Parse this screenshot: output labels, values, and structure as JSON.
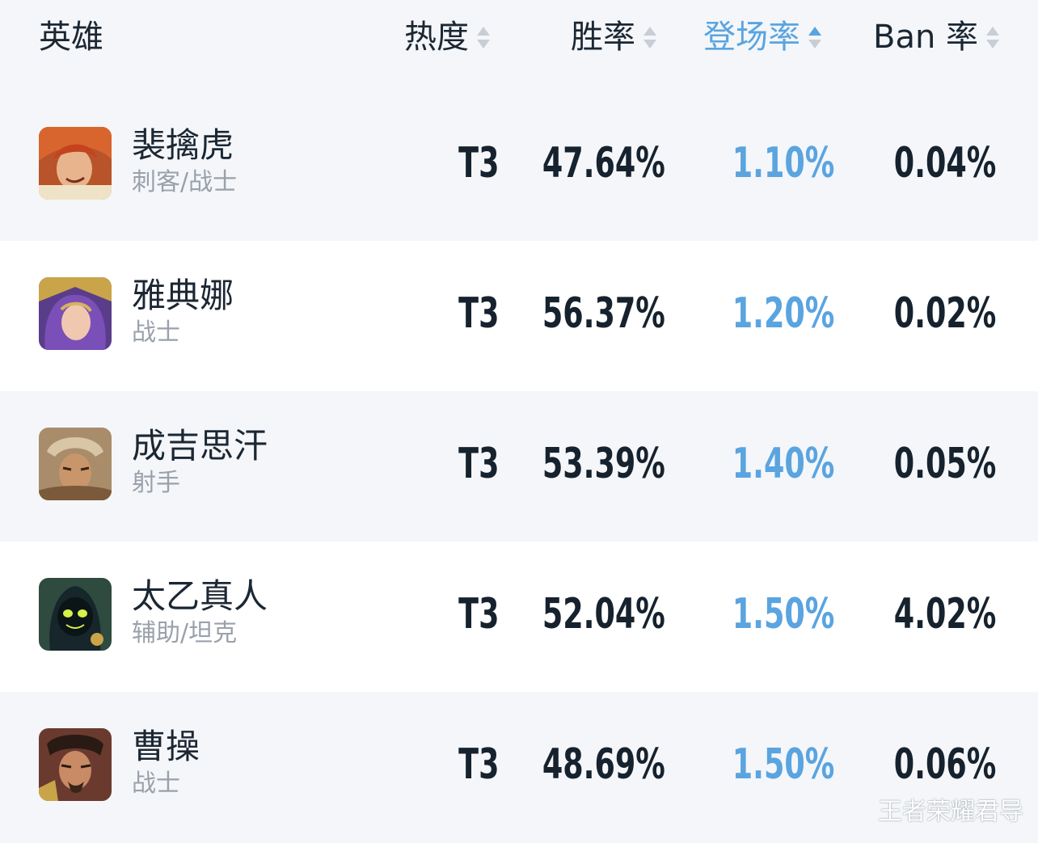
{
  "header": {
    "hero_label": "英雄",
    "heat_label": "热度",
    "win_label": "胜率",
    "appear_label": "登场率",
    "ban_label": "Ban 率"
  },
  "active_sort_column": "登场率",
  "colors": {
    "accent": "#5aa4e0",
    "text": "#16222e",
    "subtext": "#9aa1ab",
    "row_alt": "#f4f6f9",
    "row": "#ffffff"
  },
  "rows": [
    {
      "name": "裴擒虎",
      "role": "刺客/战士",
      "heat": "T3",
      "win_rate": "47.64%",
      "appear_rate": "1.10%",
      "ban_rate": "0.04%",
      "avatar_icon": "hero-avatar-icon"
    },
    {
      "name": "雅典娜",
      "role": "战士",
      "heat": "T3",
      "win_rate": "56.37%",
      "appear_rate": "1.20%",
      "ban_rate": "0.02%",
      "avatar_icon": "hero-avatar-icon"
    },
    {
      "name": "成吉思汗",
      "role": "射手",
      "heat": "T3",
      "win_rate": "53.39%",
      "appear_rate": "1.40%",
      "ban_rate": "0.05%",
      "avatar_icon": "hero-avatar-icon"
    },
    {
      "name": "太乙真人",
      "role": "辅助/坦克",
      "heat": "T3",
      "win_rate": "52.04%",
      "appear_rate": "1.50%",
      "ban_rate": "4.02%",
      "avatar_icon": "hero-avatar-icon"
    },
    {
      "name": "曹操",
      "role": "战士",
      "heat": "T3",
      "win_rate": "48.69%",
      "appear_rate": "1.50%",
      "ban_rate": "0.06%",
      "avatar_icon": "hero-avatar-icon"
    }
  ],
  "watermark": "王者荣耀君导"
}
